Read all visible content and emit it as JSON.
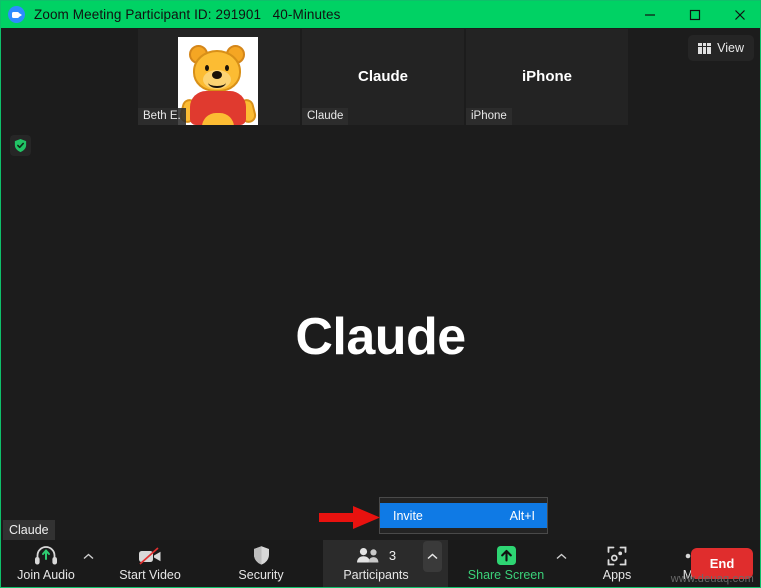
{
  "window": {
    "title": "Zoom Meeting Participant ID: 291901   40-Minutes",
    "logo_icon": "zoom-camera-icon",
    "minimize_label": "—",
    "maximize_label": "☐",
    "close_label": "✕",
    "titlebar_color": "#00d264"
  },
  "thumbnails": [
    {
      "tag": "Beth E.",
      "center_name": "",
      "has_avatar": true,
      "avatar_icon": "winnie-the-pooh-avatar"
    },
    {
      "tag": "Claude",
      "center_name": "Claude",
      "has_avatar": false,
      "avatar_icon": ""
    },
    {
      "tag": "iPhone",
      "center_name": "iPhone",
      "has_avatar": false,
      "avatar_icon": ""
    }
  ],
  "view_button": {
    "label": "View",
    "icon": "layout-grid-icon"
  },
  "encryption": {
    "icon": "shield-check-icon",
    "color": "#21c465"
  },
  "stage": {
    "name": "Claude",
    "name_tag": "Claude"
  },
  "invite_menu": {
    "item_label": "Invite",
    "item_shortcut": "Alt+I",
    "highlight_color": "#0f7ae5"
  },
  "annotation": {
    "arrow_icon": "red-right-arrow",
    "arrow_color": "#e8120f"
  },
  "toolbar": {
    "join_audio": {
      "label": "Join Audio",
      "icon": "headset-join-audio-icon",
      "caret": "˄"
    },
    "start_video": {
      "label": "Start Video",
      "icon": "video-camera-off-icon"
    },
    "security": {
      "label": "Security",
      "icon": "shield-icon"
    },
    "participants": {
      "label": "Participants",
      "icon": "people-icon",
      "count": "3",
      "caret": "˄"
    },
    "share_screen": {
      "label": "Share Screen",
      "icon": "share-screen-up-arrow-icon",
      "caret": "˄"
    },
    "apps": {
      "label": "Apps",
      "icon": "apps-bracket-icon"
    },
    "more": {
      "label": "More",
      "icon": "ellipsis-icon"
    },
    "end": {
      "label": "End"
    }
  },
  "watermark": "www.deuaq.com"
}
